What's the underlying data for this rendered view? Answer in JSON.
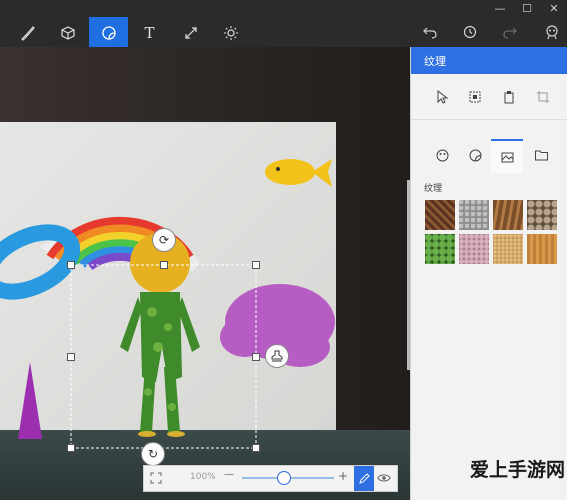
{
  "toolbar": {
    "tools": [
      {
        "name": "brushes",
        "icon": "brush-icon"
      },
      {
        "name": "3d-shapes",
        "icon": "cube-icon"
      },
      {
        "name": "stickers",
        "icon": "sticker-icon",
        "active": true
      },
      {
        "name": "text",
        "icon": "text-icon",
        "glyph": "T"
      },
      {
        "name": "canvas",
        "icon": "canvas-resize-icon"
      },
      {
        "name": "effects",
        "icon": "sun-icon"
      }
    ],
    "right_tools": [
      "undo-icon",
      "history-icon",
      "redo-icon",
      "community-icon"
    ],
    "window_controls": [
      "—",
      "☐",
      "✕"
    ]
  },
  "panel": {
    "title": "纹理",
    "section_label": "纹理",
    "top_tools": [
      "select-icon",
      "canvas-select-icon",
      "paste-icon",
      "crop-icon"
    ],
    "tabs": [
      "stickers-tab-icon",
      "shapes-tab-icon",
      "textures-tab-icon",
      "folder-icon"
    ],
    "active_tab": 2,
    "textures": [
      {
        "name": "wood-bark",
        "color": "#7a4a2e"
      },
      {
        "name": "gravel",
        "color": "#9a9a9a"
      },
      {
        "name": "wood-grain",
        "color": "#9a6a3a"
      },
      {
        "name": "pebbles",
        "color": "#8a7a6a"
      },
      {
        "name": "leaves",
        "color": "#3a7a2a"
      },
      {
        "name": "pink-granite",
        "color": "#b88a98"
      },
      {
        "name": "sand",
        "color": "#d4a868"
      },
      {
        "name": "light-wood",
        "color": "#c88a3a"
      }
    ]
  },
  "zoom": {
    "level": "100%",
    "slider_fraction": 0.45,
    "minus": "—",
    "plus": "+"
  },
  "accent": "#1f6fe0",
  "watermark": "爱上手游网"
}
